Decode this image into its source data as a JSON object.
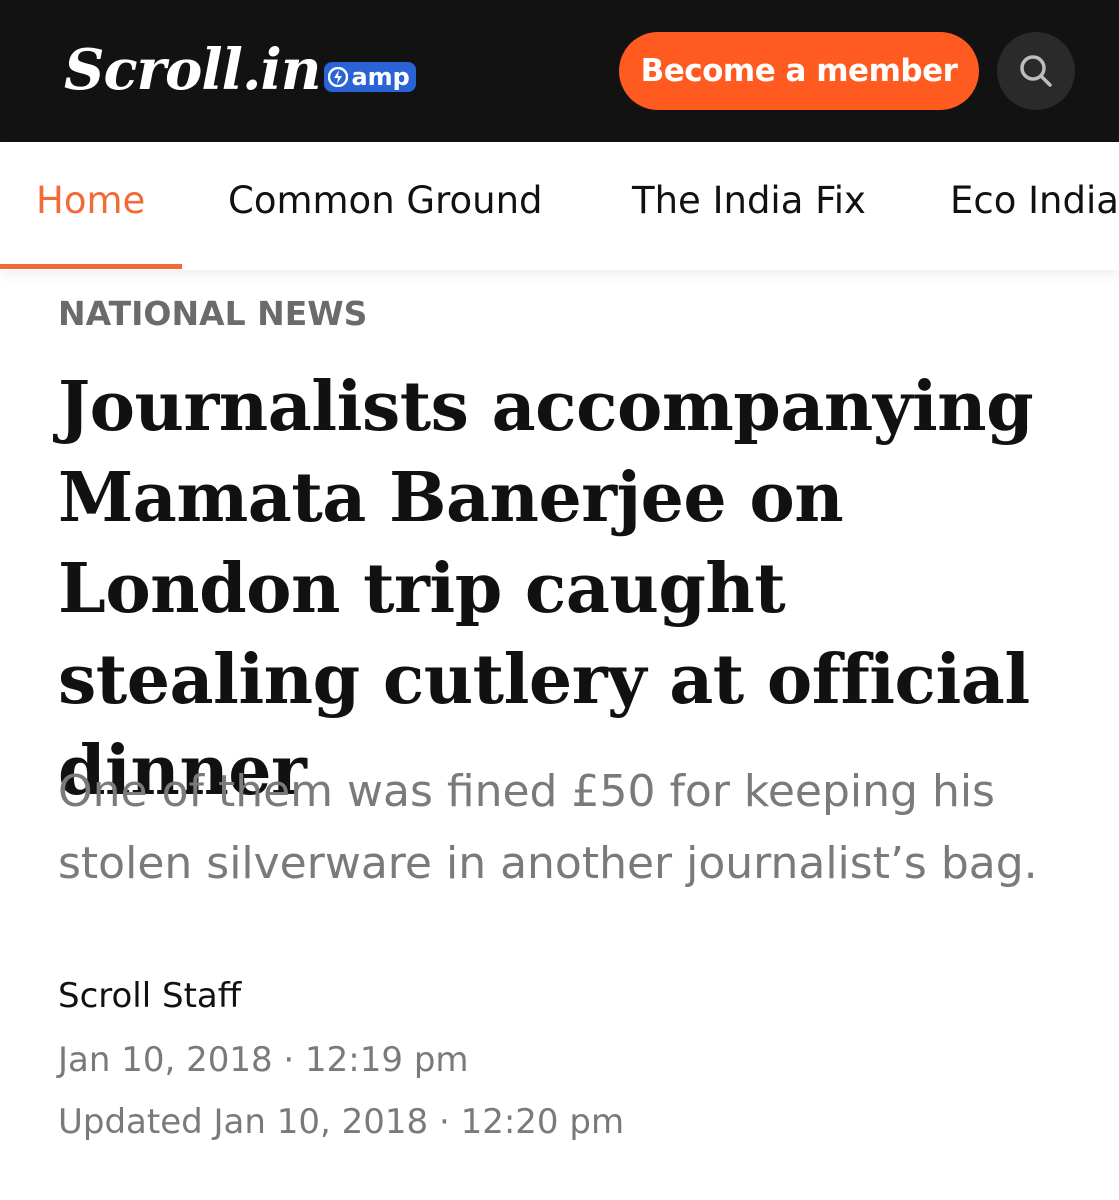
{
  "header": {
    "logo_text": "Scroll.in",
    "amp_label": "amp",
    "member_button_label": "Become a member",
    "brand_color": "#ff5a1f",
    "search_icon": "search-icon"
  },
  "nav": {
    "items": [
      {
        "label": "Home",
        "active": true
      },
      {
        "label": "Common Ground",
        "active": false
      },
      {
        "label": "The India Fix",
        "active": false
      },
      {
        "label": "Eco India",
        "active": false
      }
    ],
    "active_color": "#f26a35"
  },
  "article": {
    "category": "NATIONAL NEWS",
    "headline": "Journalists accompanying Mamata Banerjee on London trip caught stealing cutlery at official dinner",
    "subhead": "One of them was fined £50 for keeping his stolen silverware in another journalist’s bag.",
    "author": "Scroll Staff",
    "published": "Jan 10, 2018 · 12:19 pm",
    "updated": "Updated Jan 10, 2018 · 12:20 pm"
  }
}
